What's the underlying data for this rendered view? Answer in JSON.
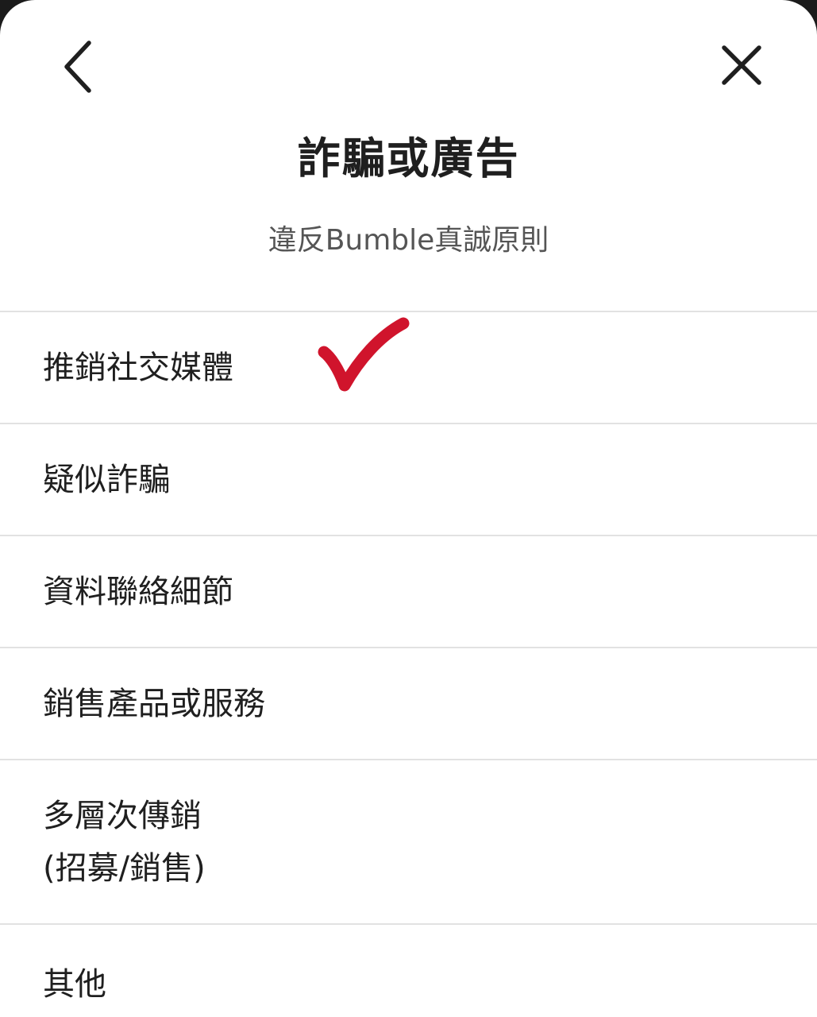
{
  "dialog": {
    "title": "詐騙或廣告",
    "subtitle": "違反Bumble真誠原則",
    "back_icon": "chevron-left-icon",
    "close_icon": "close-icon"
  },
  "options": [
    {
      "label": "推銷社交媒體",
      "annotation": "red-checkmark"
    },
    {
      "label": "疑似詐騙"
    },
    {
      "label": "資料聯絡細節"
    },
    {
      "label": "銷售產品或服務"
    },
    {
      "label": "多層次傳銷\n(招募/銷售)"
    },
    {
      "label": "其他"
    }
  ],
  "colors": {
    "background": "#ffffff",
    "text": "#1f1f1f",
    "subtitle": "#555555",
    "divider": "#e2e2e2",
    "checkmark": "#d0142c"
  }
}
